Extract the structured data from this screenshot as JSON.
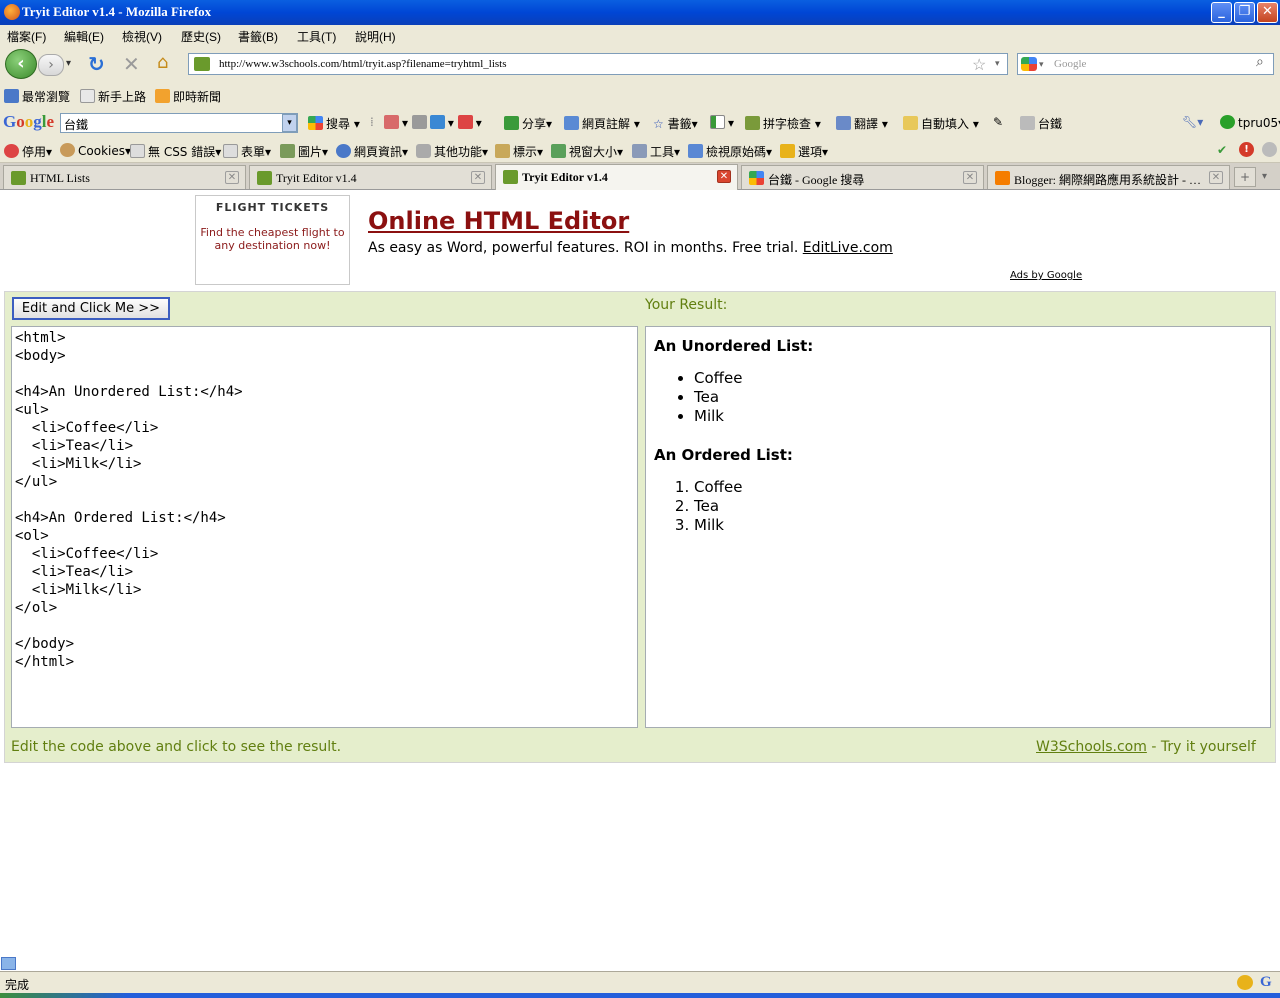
{
  "window": {
    "title": "Tryit Editor v1.4 - Mozilla Firefox"
  },
  "menu": [
    "檔案(F)",
    "編輯(E)",
    "檢視(V)",
    "歷史(S)",
    "書籤(B)",
    "工具(T)",
    "說明(H)"
  ],
  "nav": {
    "url": "http://www.w3schools.com/html/tryit.asp?filename=tryhtml_lists",
    "search_placeholder": "Google"
  },
  "bookmarks": [
    "最常瀏覽",
    "新手上路",
    "即時新聞"
  ],
  "google_toolbar": {
    "logo": "Google",
    "query": "台鐵",
    "items": [
      "搜尋",
      "分享",
      "網頁註解",
      "書籤",
      "拼字檢查",
      "翻譯",
      "自動填入",
      "台鐵",
      "tpru05"
    ]
  },
  "webdev_toolbar": [
    "停用",
    "Cookies",
    "無 CSS 錯誤",
    "表單",
    "圖片",
    "網頁資訊",
    "其他功能",
    "標示",
    "視窗大小",
    "工具",
    "檢視原始碼",
    "選項"
  ],
  "tabs": [
    {
      "label": "HTML Lists",
      "active": false
    },
    {
      "label": "Tryit Editor v1.4",
      "active": false
    },
    {
      "label": "Tryit Editor v1.4",
      "active": true
    },
    {
      "label": "台鐵 - Google 搜尋",
      "active": false
    },
    {
      "label": "Blogger: 網際網路應用系統設計 - …",
      "active": false
    }
  ],
  "ad": {
    "box_title": "FLIGHT TICKETS",
    "box_text": "Find the cheapest flight to any destination now!",
    "headline": "Online HTML Editor",
    "text": "As easy as Word, powerful features. ROI in months. Free trial.",
    "link": "EditLive.com",
    "ads_by": "Ads by Google"
  },
  "tryit": {
    "button": "Edit and Click Me >>",
    "result_label": "Your Result:",
    "code": "<html>\n<body>\n\n<h4>An Unordered List:</h4>\n<ul>\n  <li>Coffee</li>\n  <li>Tea</li>\n  <li>Milk</li>\n</ul>\n\n<h4>An Ordered List:</h4>\n<ol>\n  <li>Coffee</li>\n  <li>Tea</li>\n  <li>Milk</li>\n</ol>\n\n</body>\n</html>",
    "result": {
      "ul_heading": "An Unordered List:",
      "ul_items": [
        "Coffee",
        "Tea",
        "Milk"
      ],
      "ol_heading": "An Ordered List:",
      "ol_items": [
        "Coffee",
        "Tea",
        "Milk"
      ]
    },
    "footer_left": "Edit the code above and click to see the result.",
    "footer_link": "W3Schools.com",
    "footer_right": " - Try it yourself"
  },
  "status": {
    "text": "完成"
  },
  "colors": {
    "accent_green": "#617f10",
    "tryit_bg": "#e5eecc",
    "ad_red": "#8b1010"
  }
}
